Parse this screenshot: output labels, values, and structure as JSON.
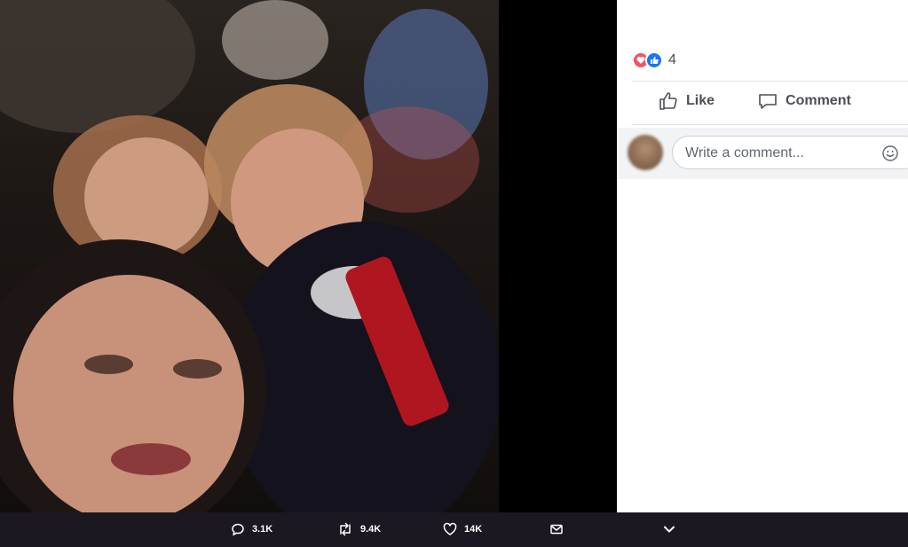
{
  "post": {
    "reactions": {
      "icons": [
        "love-icon",
        "like-icon"
      ],
      "count": "4"
    },
    "actions": [
      {
        "label": "Like",
        "icon": "thumbs-up-icon"
      },
      {
        "label": "Comment",
        "icon": "speech-bubble-icon"
      }
    ],
    "comment": {
      "placeholder": "Write a comment...",
      "icon": "smiley-icon"
    }
  },
  "bottom_bar": {
    "replies": "3.1K",
    "retweets": "9.4K",
    "likes": "14K",
    "icons": [
      "reply-icon",
      "retweet-icon",
      "heart-icon",
      "message-icon",
      "chevron-down-icon"
    ]
  },
  "colors": {
    "love": "#f25268",
    "like": "#1877f2",
    "bottom_bar_bg": "#1c1821"
  }
}
